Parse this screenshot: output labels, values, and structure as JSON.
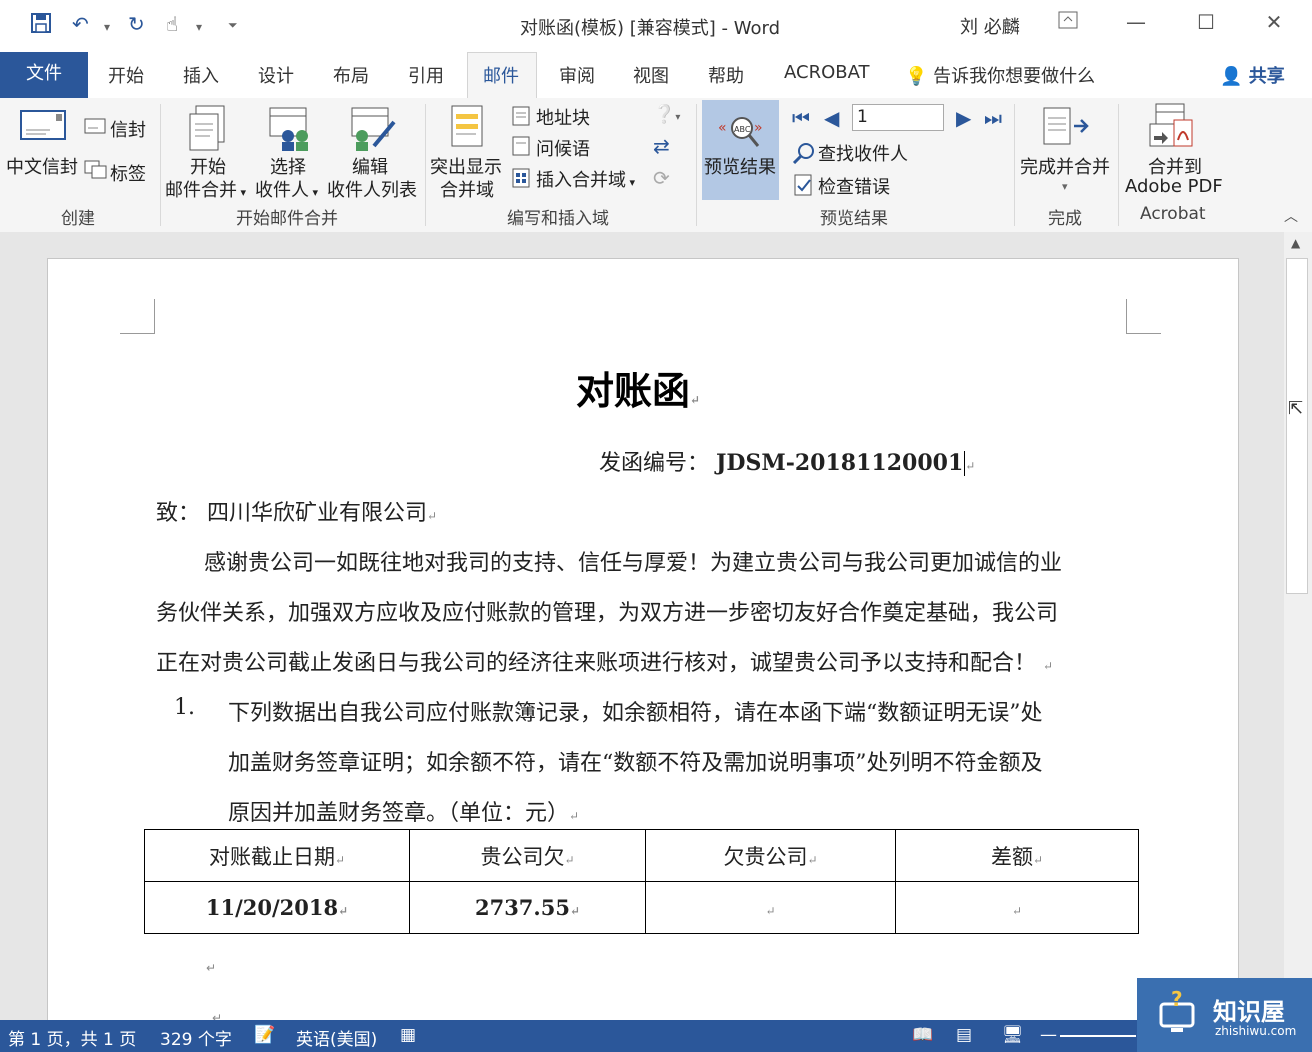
{
  "window": {
    "title": "对账函(模板) [兼容模式]  -  Word",
    "user": "刘 必麟"
  },
  "tabs": {
    "file": "文件",
    "items": [
      "开始",
      "插入",
      "设计",
      "布局",
      "引用",
      "邮件",
      "审阅",
      "视图",
      "帮助",
      "ACROBAT"
    ],
    "tell_me": "告诉我你想要做什么",
    "share": "共享"
  },
  "ribbon": {
    "create": {
      "group": "创建",
      "envelope_zh": "中文信封",
      "envelopes": "信封",
      "labels": "标签"
    },
    "start_merge": {
      "group": "开始邮件合并",
      "start_line1": "开始",
      "start_line2": "邮件合并",
      "select_line1": "选择",
      "select_line2": "收件人",
      "edit_line1": "编辑",
      "edit_line2": "收件人列表"
    },
    "write_insert": {
      "group": "编写和插入域",
      "highlight_line1": "突出显示",
      "highlight_line2": "合并域",
      "address_block": "地址块",
      "greeting_line": "问候语",
      "insert_merge_field": "插入合并域"
    },
    "preview": {
      "group": "预览结果",
      "preview_results": "预览结果",
      "record_number": "1",
      "find_recipient": "查找收件人",
      "check_errors": "检查错误"
    },
    "finish": {
      "group": "完成",
      "finish_merge": "完成并合并"
    },
    "acrobat": {
      "group": "Acrobat",
      "merge_line1": "合并到",
      "merge_line2": "Adobe PDF"
    }
  },
  "document": {
    "title": "对账函",
    "ref_label": "发函编号：",
    "ref_number": "JDSM-20181120001",
    "to_line": "致：  四川华欣矿业有限公司",
    "body_line1": "感谢贵公司一如既往地对我司的支持、信任与厚爱！为建立贵公司与我公司更加诚信的业",
    "body_line2": "务伙伴关系，加强双方应收及应付账款的管理，为双方进一步密切友好合作奠定基础，我公司",
    "body_line3": "正在对贵公司截止发函日与我公司的经济往来账项进行核对，诚望贵公司予以支持和配合！",
    "item_number": "1.",
    "item_line1": "下列数据出自我公司应付账款簿记录，如余额相符，请在本函下端“数额证明无误”处",
    "item_line2": "加盖财务签章证明；如余额不符，请在“数额不符及需加说明事项”处列明不符金额及",
    "item_line3": "原因并加盖财务签章。（单位：元）",
    "table": {
      "headers": [
        "对账截止日期",
        "贵公司欠",
        "欠贵公司",
        "差额"
      ],
      "row": [
        "11/20/2018",
        "2737.55",
        "",
        ""
      ]
    }
  },
  "statusbar": {
    "page": "第 1 页，共 1 页",
    "words": "329 个字",
    "language": "英语(美国)"
  },
  "watermark": {
    "brand": "知识屋",
    "url": "zhishiwu.com"
  },
  "colors": {
    "accent": "#2b579a",
    "preview_active": "#b3c8e4"
  }
}
